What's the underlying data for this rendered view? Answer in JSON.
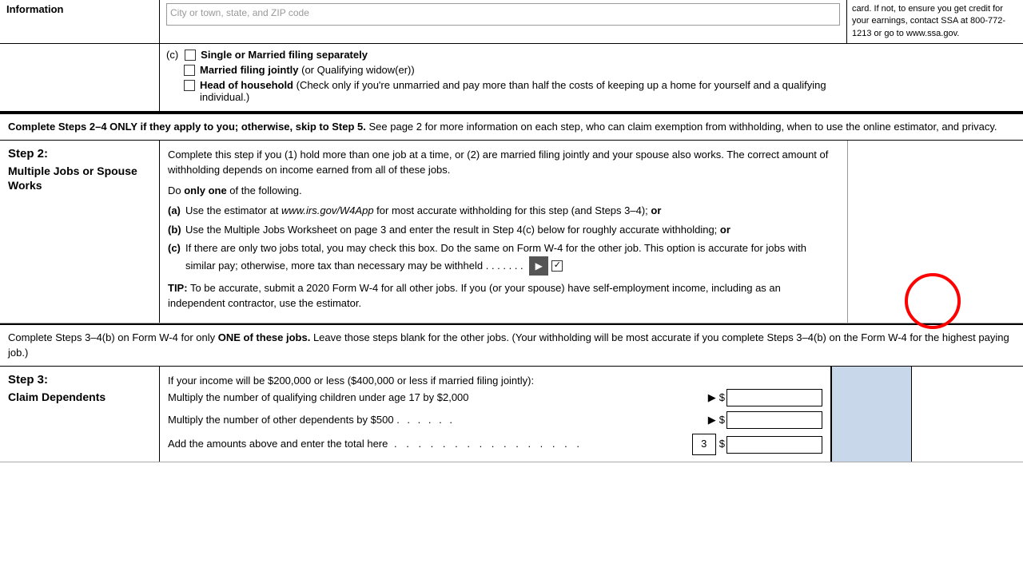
{
  "header": {
    "left_label": "Information",
    "city_placeholder": "City or town, state, and ZIP code",
    "right_note": "card. If not, to ensure you get credit for your earnings, contact SSA at 800-772-1213 or go to www.ssa.gov."
  },
  "filing_section": {
    "label_c": "(c)",
    "option1": "Single or Married filing separately",
    "option2_bold": "Married filing jointly",
    "option2_rest": " (or Qualifying widow(er))",
    "option3_bold": "Head of household",
    "option3_rest": " (Check only if you're unmarried and pay more than half the costs of keeping up a home for yourself and a qualifying individual.)"
  },
  "complete_banner1": {
    "text": "Complete Steps 2–4 ONLY if they apply to you; otherwise, skip to Step 5.",
    "text2": " See page 2 for more information on each step, who can claim exemption from withholding, when to use the online estimator, and privacy."
  },
  "step2": {
    "number": "Step 2:",
    "title": "Multiple Jobs or Spouse Works",
    "intro": "Complete this step if you (1) hold more than one job at a time, or (2) are married filing jointly and your spouse also works. The correct amount of withholding depends on income earned from all of these jobs.",
    "do_only_one": "Do ",
    "do_only_one_bold": "only one",
    "do_only_one_rest": " of the following.",
    "item_a_letter": "(a)",
    "item_a_text": "Use the estimator at ",
    "item_a_link": "www.irs.gov/W4App",
    "item_a_rest": " for most accurate withholding for this step (and Steps 3–4); ",
    "item_a_or": "or",
    "item_b_letter": "(b)",
    "item_b_text": "Use the Multiple Jobs Worksheet on page 3 and enter the result in Step 4(c) below for roughly accurate withholding; ",
    "item_b_or": "or",
    "item_c_letter": "(c)",
    "item_c_text": "If there are only two jobs total, you may check this box. Do the same on Form W-4 for the other job. This option is accurate for jobs with similar pay; otherwise, more tax than necessary may be withheld . . . . . . .",
    "tip_label": "TIP:",
    "tip_text": " To be accurate, submit a 2020 Form W-4 for all other jobs. If you (or your spouse) have self-employment income, including as an independent contractor, use the estimator."
  },
  "complete_banner2": {
    "text": "Complete Steps 3–4(b) on Form W-4 for only ",
    "text_bold": "ONE of these jobs.",
    "text2": " Leave those steps blank for the other jobs. (Your withholding will be most accurate if you complete Steps 3–4(b) on the Form W-4 for the highest paying job.)"
  },
  "step3": {
    "number": "Step 3:",
    "title": "Claim Dependents",
    "intro": "If your income will be $200,000 or less ($400,000 or less if married filing jointly):",
    "row1_text": "Multiply the number of qualifying children under age 17 by $2,000",
    "row1_arrow": "▶",
    "row1_dollar": "$",
    "row2_text": "Multiply the number of other dependents by $500",
    "row2_dots": ". . . . . .",
    "row2_arrow": "▶",
    "row2_dollar": "$",
    "total_text": "Add the amounts above and enter the total here",
    "total_dots": ". . . . . . . . . . . . . . . .",
    "total_box": "3",
    "total_dollar": "$"
  }
}
